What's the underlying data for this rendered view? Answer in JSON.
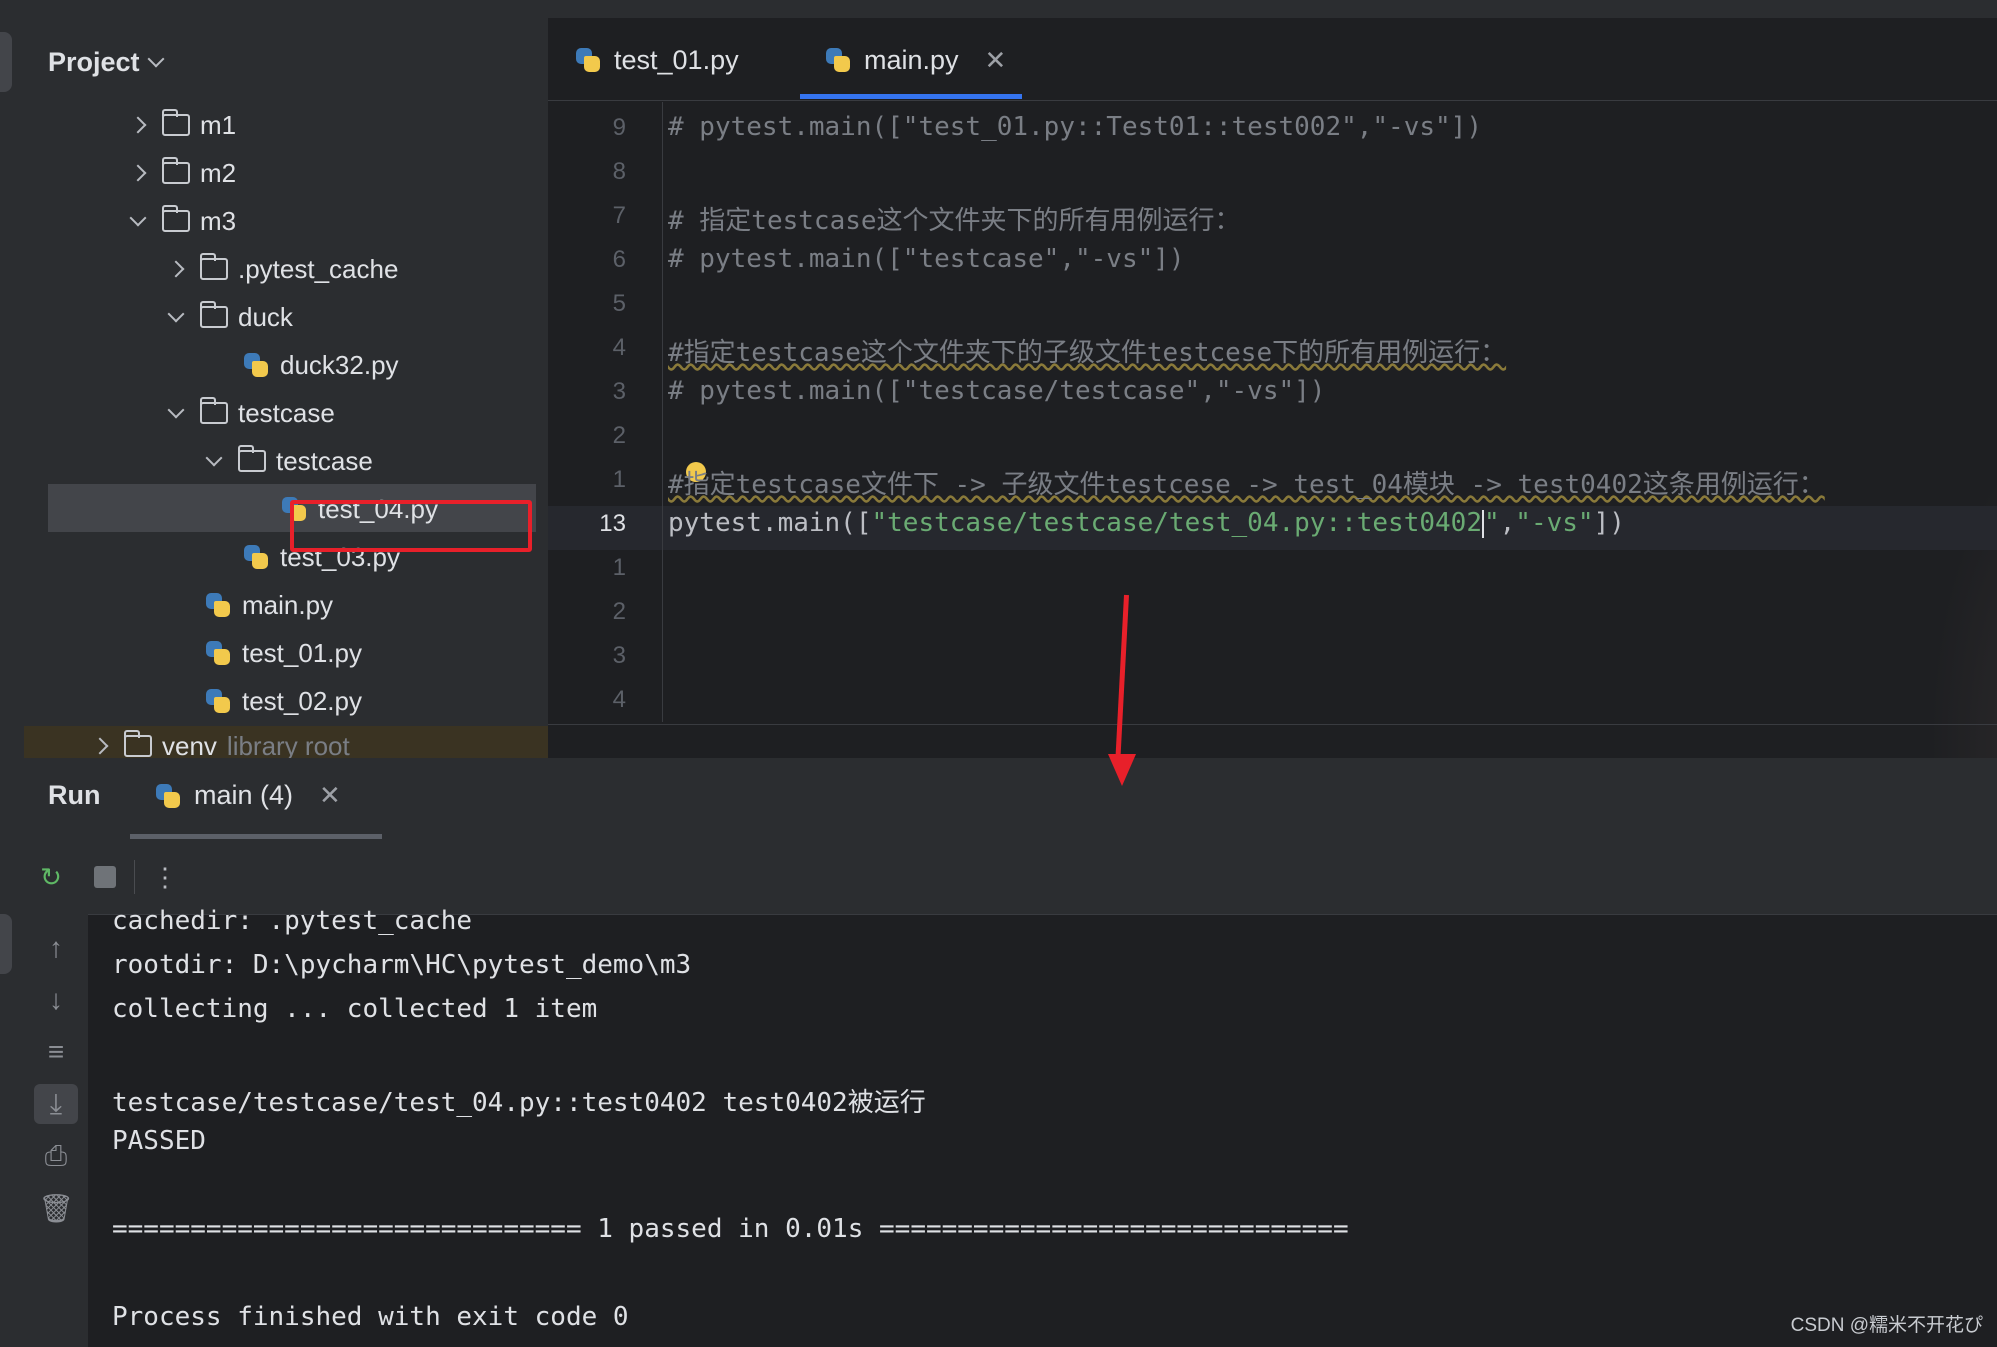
{
  "project": {
    "title": "Project",
    "tree": [
      {
        "label": "m1",
        "type": "folder",
        "expanded": false
      },
      {
        "label": "m2",
        "type": "folder",
        "expanded": false
      },
      {
        "label": "m3",
        "type": "folder",
        "expanded": true
      },
      {
        "label": ".pytest_cache",
        "type": "folder",
        "expanded": false
      },
      {
        "label": "duck",
        "type": "folder",
        "expanded": true
      },
      {
        "label": "duck32.py",
        "type": "python-file"
      },
      {
        "label": "testcase",
        "type": "folder",
        "expanded": true
      },
      {
        "label": "testcase",
        "type": "folder",
        "expanded": true
      },
      {
        "label": "test_04.py",
        "type": "python-file",
        "selected": true
      },
      {
        "label": "test_03.py",
        "type": "python-file"
      },
      {
        "label": "main.py",
        "type": "python-file"
      },
      {
        "label": "test_01.py",
        "type": "python-file"
      },
      {
        "label": "test_02.py",
        "type": "python-file"
      }
    ],
    "venv": {
      "label": "venv",
      "suffix": "library root"
    }
  },
  "editor": {
    "tabs": [
      {
        "label": "test_01.py",
        "active": false
      },
      {
        "label": "main.py",
        "active": true
      }
    ],
    "line_numbers": [
      "9",
      "8",
      "7",
      "6",
      "5",
      "4",
      "3",
      "2",
      "1",
      "13",
      "1",
      "2",
      "3",
      "4"
    ],
    "lines": {
      "l1": "# pytest.main([\"test_01.py::Test01::test002\",\"-vs\"])",
      "l3": "# 指定testcase这个文件夹下的所有用例运行：",
      "l4": "# pytest.main([\"testcase\",\"-vs\"])",
      "l6": "#指定testcase这个文件夹下的子级文件testcese下的所有用例运行：",
      "l7": "# pytest.main([\"testcase/testcase\",\"-vs\"])",
      "l9": "#指定testcase文件下 -> 子级文件testcese -> test_04模块 -> test0402这条用例运行：",
      "l10_a": "pytest.main([",
      "l10_b": "\"testcase/testcase/test_04.py::test0402",
      "l10_c": "\"",
      "l10_d": ",",
      "l10_e": "\"-vs\"",
      "l10_f": "])"
    }
  },
  "run": {
    "title": "Run",
    "tab_label": "main (4)",
    "console": [
      "cachedir: .pytest_cache",
      "rootdir: D:\\pycharm\\HC\\pytest_demo\\m3",
      "collecting ... collected 1 item",
      "",
      "testcase/testcase/test_04.py::test0402 test0402被运行",
      "PASSED",
      "",
      "============================== 1 passed in 0.01s ==============================",
      "",
      "Process finished with exit code 0"
    ]
  },
  "watermark": "CSDN @糯米不开花ぴ",
  "colors": {
    "accent": "#3574f0",
    "annotation_red": "#e8202a",
    "string_green": "#6aab73",
    "comment_gray": "#7a7e85"
  }
}
